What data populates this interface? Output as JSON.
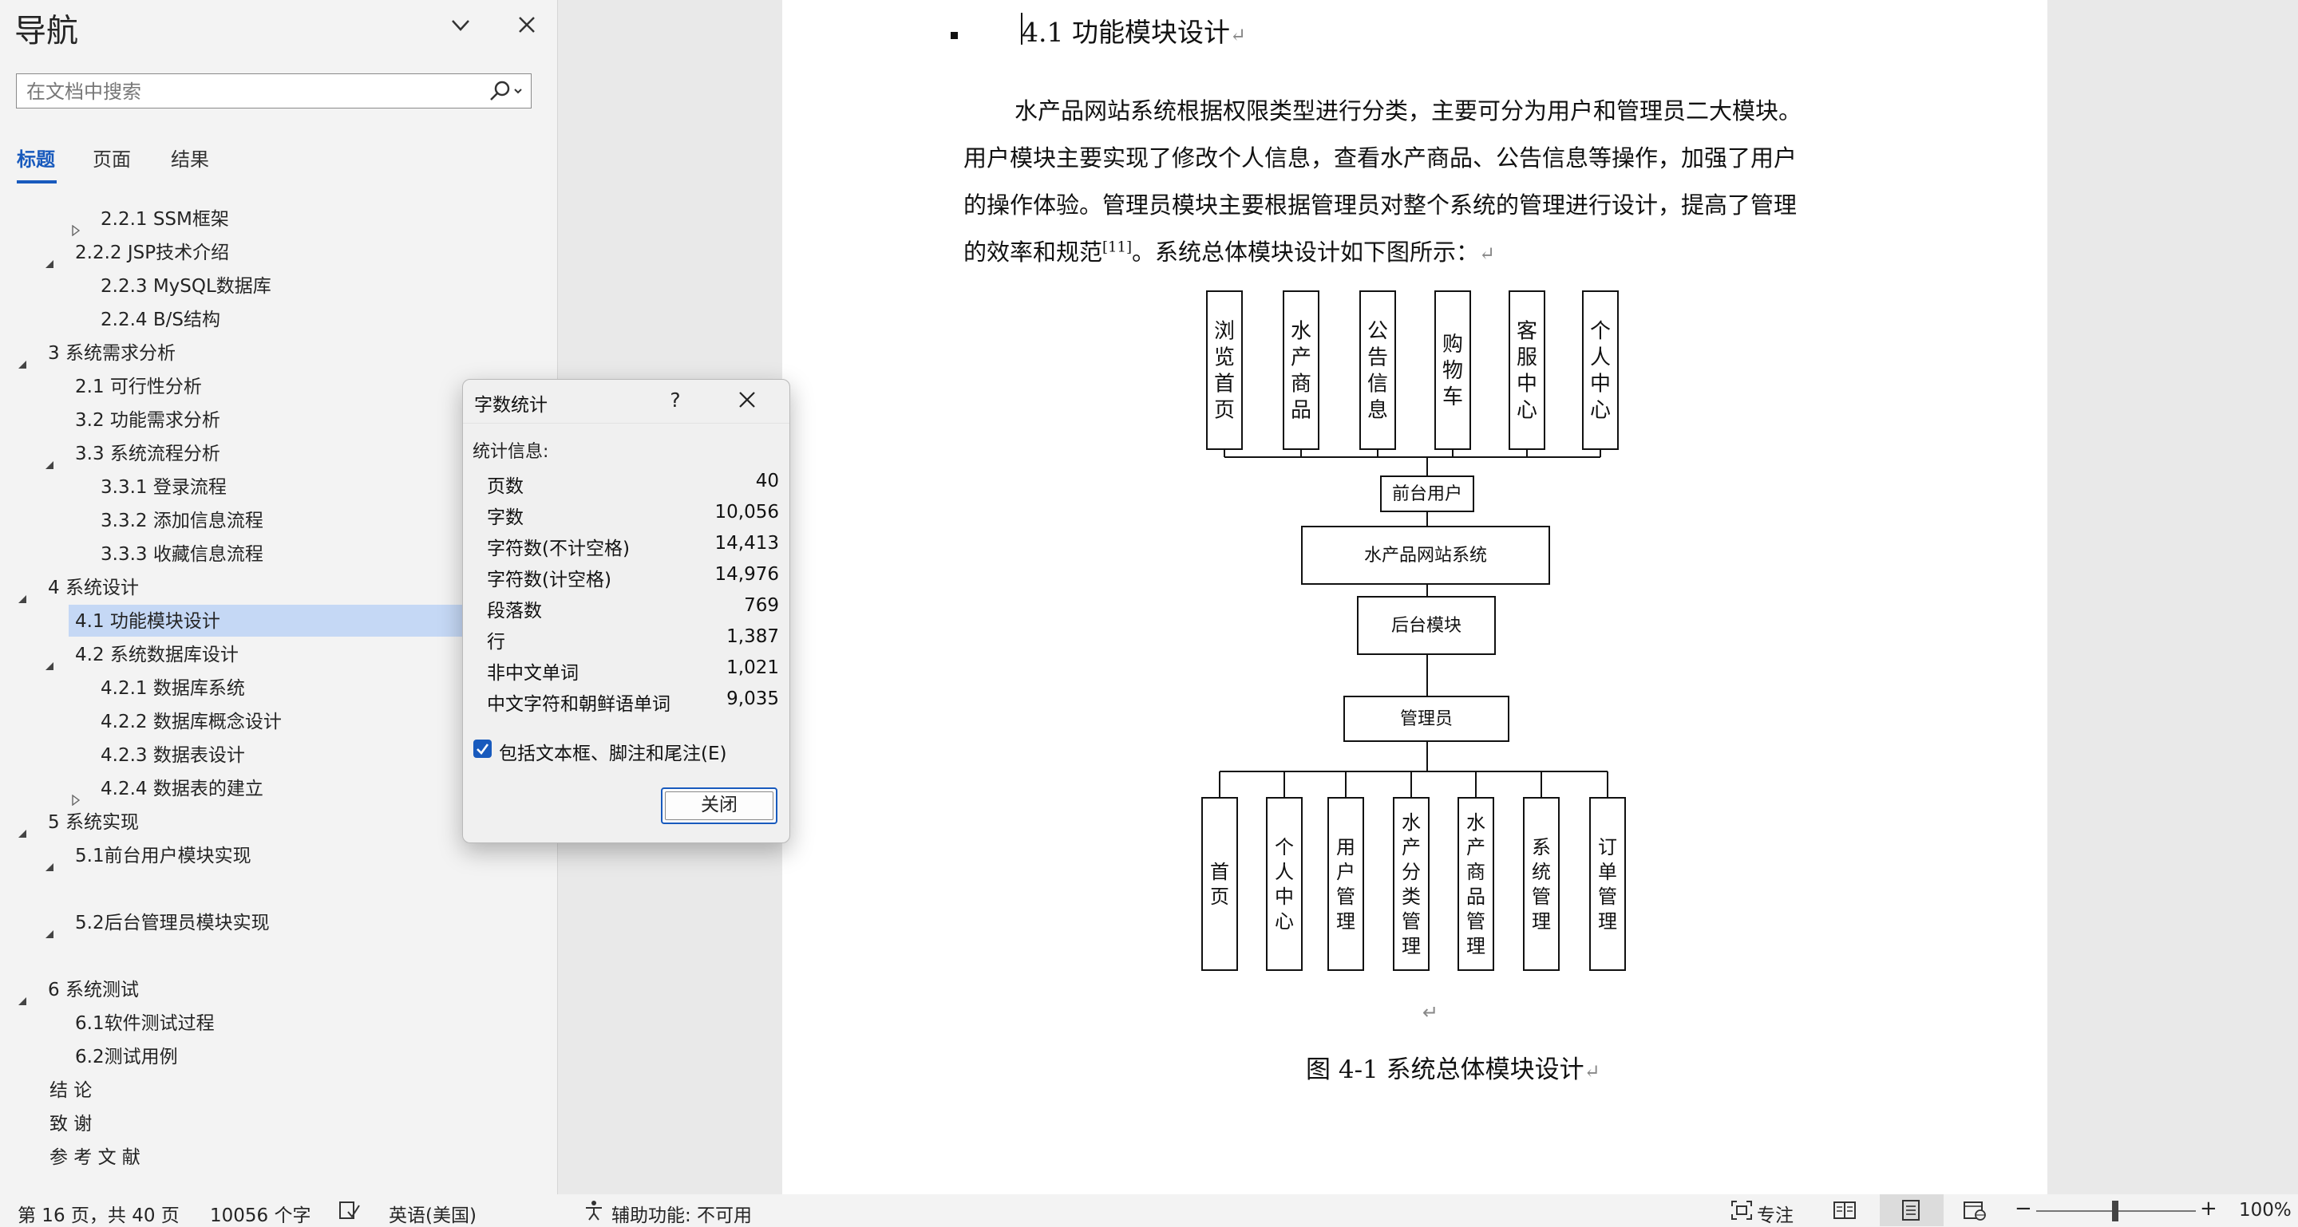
{
  "nav": {
    "title": "导航",
    "search_placeholder": "在文档中搜索",
    "tabs": [
      "标题",
      "页面",
      "结果"
    ],
    "items": [
      {
        "label": "2.2.1  SSM框架",
        "toggle": "collapsed"
      },
      {
        "label": "2.2.2 JSP技术介绍",
        "toggle": "expanded"
      },
      {
        "label": "2.2.3 MySQL数据库",
        "toggle": "none"
      },
      {
        "label": "2.2.4 B/S结构",
        "toggle": "none"
      },
      {
        "label": "3  系统需求分析",
        "toggle": "expanded"
      },
      {
        "label": "2.1 可行性分析",
        "toggle": "none"
      },
      {
        "label": "3.2 功能需求分析",
        "toggle": "none"
      },
      {
        "label": "3.3 系统流程分析",
        "toggle": "expanded"
      },
      {
        "label": "3.3.1 登录流程",
        "toggle": "none"
      },
      {
        "label": "3.3.2 添加信息流程",
        "toggle": "none"
      },
      {
        "label": "3.3.3 收藏信息流程",
        "toggle": "none"
      },
      {
        "label": "4  系统设计",
        "toggle": "expanded"
      },
      {
        "label": "4.1 功能模块设计",
        "toggle": "none",
        "selected": true
      },
      {
        "label": "4.2 系统数据库设计",
        "toggle": "expanded"
      },
      {
        "label": "4.2.1 数据库系统",
        "toggle": "none"
      },
      {
        "label": "4.2.2 数据库概念设计",
        "toggle": "none"
      },
      {
        "label": "4.2.3 数据表设计",
        "toggle": "none"
      },
      {
        "label": "4.2.4 数据表的建立",
        "toggle": "collapsed"
      },
      {
        "label": "5  系统实现",
        "toggle": "expanded"
      },
      {
        "label": "5.1前台用户模块实现",
        "toggle": "expanded"
      },
      {
        "label": "5.2后台管理员模块实现",
        "toggle": "expanded"
      },
      {
        "label": "6  系统测试",
        "toggle": "expanded"
      },
      {
        "label": "6.1软件测试过程",
        "toggle": "none"
      },
      {
        "label": "6.2测试用例",
        "toggle": "none"
      },
      {
        "label": "结    论",
        "toggle": "none"
      },
      {
        "label": "致    谢",
        "toggle": "none"
      },
      {
        "label": "参 考 文 献",
        "toggle": "none"
      }
    ]
  },
  "dialog": {
    "title": "字数统计",
    "help": "?",
    "section": "统计信息:",
    "stats": [
      {
        "label": "页数",
        "value": "40"
      },
      {
        "label": "字数",
        "value": "10,056"
      },
      {
        "label": "字符数(不计空格)",
        "value": "14,413"
      },
      {
        "label": "字符数(计空格)",
        "value": "14,976"
      },
      {
        "label": "段落数",
        "value": "769"
      },
      {
        "label": "行",
        "value": "1,387"
      },
      {
        "label": "非中文单词",
        "value": "1,021"
      },
      {
        "label": "中文字符和朝鲜语单词",
        "value": "9,035"
      }
    ],
    "checkbox_label": "包括文本框、脚注和尾注(E)",
    "checkbox_checked": true,
    "close_label": "关闭"
  },
  "document": {
    "heading": "4.1  功能模块设计",
    "paragraph_lines": [
      "水产品网站系统根据权限类型进行分类，主要可分为用户和管理员二大模块。",
      "用户模块主要实现了修改个人信息，查看水产商品、公告信息等操作，加强了用户",
      "的操作体验。管理员模块主要根据管理员对整个系统的管理进行设计，提高了管理",
      "的效率和规范"
    ],
    "citation": "[11]",
    "paragraph_tail": "。系统总体模块设计如下图所示：",
    "paragraph_mark": "↵",
    "caption": "图 4-1  系统总体模块设计",
    "diagram": {
      "top_modules": [
        "浏览首页",
        "水产商品",
        "公告信息",
        "购物车",
        "客服中心",
        "个人中心"
      ],
      "front_user": "前台用户",
      "system": "水产品网站系统",
      "backend": "后台模块",
      "admin": "管理员",
      "bottom_modules": [
        "首页",
        "个人中心",
        "用户管理",
        "水产分类管理",
        "水产商品管理",
        "系统管理",
        "订单管理"
      ]
    }
  },
  "status_bar": {
    "page_info": "第 16 页，共 40 页",
    "word_count": "10056 个字",
    "language": "英语(美国)",
    "accessibility": "辅助功能: 不可用",
    "focus": "专注",
    "zoom": "100%",
    "zoom_level_percent": 100
  }
}
